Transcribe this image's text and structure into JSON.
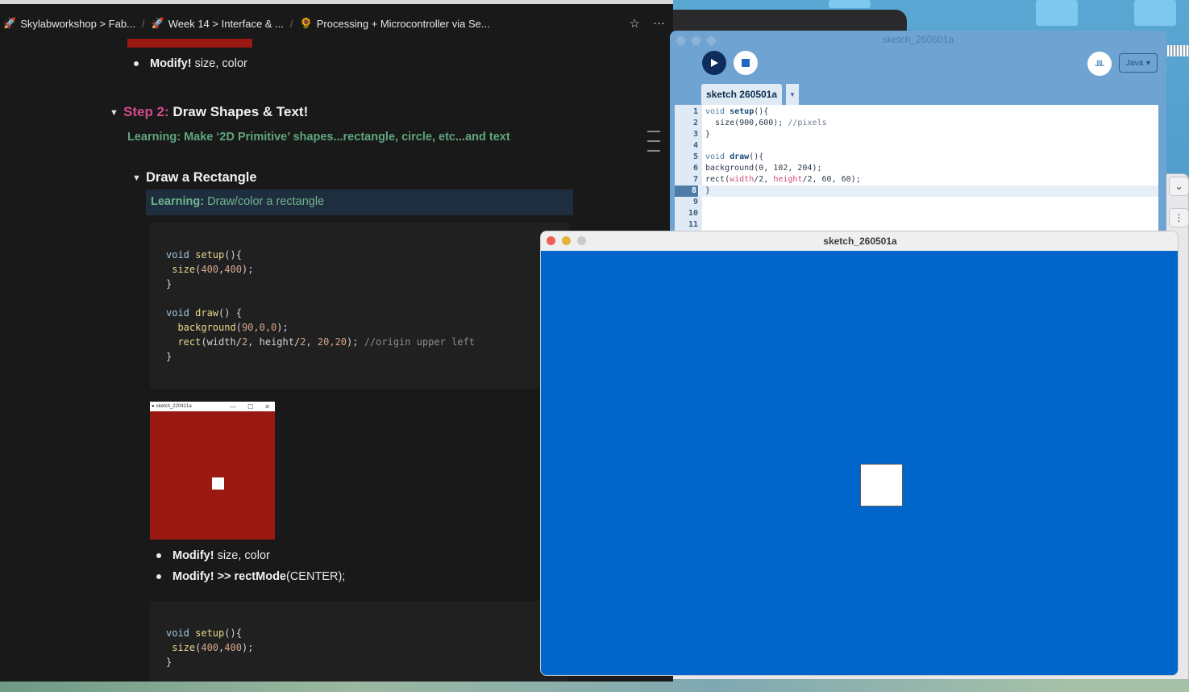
{
  "browser": {
    "breadcrumbs": [
      {
        "icon": "🚀",
        "label": "Skylabworkshop > Fab..."
      },
      {
        "icon": "🚀",
        "label": "Week 14 > Interface & ..."
      },
      {
        "icon": "🌻",
        "label": "Processing + Microcontroller via Se..."
      }
    ],
    "star_icon": "☆",
    "more_icon": "···"
  },
  "page": {
    "bullet_top": {
      "bold": "Modify!",
      "rest": " size, color"
    },
    "step_prefix": "Step 2:",
    "step_title": " Draw Shapes & Text!",
    "learning_step": "Learning: Make ‘2D Primitive’ shapes...rectangle, circle, etc...and text",
    "rect_heading": "Draw a Rectangle",
    "callout_bold": "Learning:",
    "callout_rest": " Draw/color a rectangle",
    "code1": {
      "l1_kw": "void ",
      "l1_fn": "setup",
      "l1_rest": "(){",
      "l2_fn": " size",
      "l2_a": "(",
      "l2_n1": "400",
      "l2_c": ",",
      "l2_n2": "400",
      "l2_e": ");",
      "l3": "}",
      "l5_kw": "void ",
      "l5_fn": "draw",
      "l5_rest": "() {",
      "l6_fn": "  background",
      "l6_a": "(",
      "l6_n": "90,0,0",
      "l6_e": ");",
      "l7_fn": "  rect",
      "l7_a": "(width/",
      "l7_n1": "2",
      "l7_b": ", height/",
      "l7_n2": "2",
      "l7_c": ", ",
      "l7_n3": "20,20",
      "l7_d": "); ",
      "l7_cm": "//origin upper left",
      "l8": "}"
    },
    "thumb_title": "sketch_220421a",
    "bullet_a": {
      "bold": "Modify!",
      "rest": "  size, color"
    },
    "bullet_b": {
      "bold": "Modify! >> rectMode",
      "rest": "(CENTER);"
    },
    "code2": {
      "l1_kw": "void ",
      "l1_fn": "setup",
      "l1_rest": "(){",
      "l2_fn": " size",
      "l2_a": "(",
      "l2_n1": "400",
      "l2_c": ",",
      "l2_n2": "400",
      "l2_e": ");",
      "l3": "}"
    }
  },
  "ide": {
    "window_title": "sketch_260501a",
    "tab_label": "sketch 260501a",
    "tab_menu": "▼",
    "mode_label": "Java",
    "mode_caret": "▾",
    "debug_icon": "ꔛ",
    "lines": [
      {
        "n": "1",
        "parts": [
          [
            "kw",
            "void "
          ],
          [
            "fn",
            "setup"
          ],
          [
            "",
            "(){"
          ]
        ]
      },
      {
        "n": "2",
        "parts": [
          [
            "",
            "  size(900,600); "
          ],
          [
            "cm",
            "//pixels"
          ]
        ]
      },
      {
        "n": "3",
        "parts": [
          [
            "",
            "}"
          ]
        ]
      },
      {
        "n": "4",
        "parts": []
      },
      {
        "n": "5",
        "parts": [
          [
            "kw",
            "void "
          ],
          [
            "fn",
            "draw"
          ],
          [
            "",
            "(){"
          ]
        ]
      },
      {
        "n": "6",
        "parts": [
          [
            "",
            "background(0, 102, 204);"
          ]
        ]
      },
      {
        "n": "7",
        "parts": [
          [
            "",
            "rect("
          ],
          [
            "red",
            "width"
          ],
          [
            "",
            "/2, "
          ],
          [
            "red",
            "height"
          ],
          [
            "",
            "/2, 60, 60);"
          ]
        ]
      },
      {
        "n": "8",
        "parts": [
          [
            "",
            "}"
          ]
        ]
      },
      {
        "n": "9",
        "parts": []
      },
      {
        "n": "10",
        "parts": []
      },
      {
        "n": "11",
        "parts": []
      }
    ],
    "current_line": 8
  },
  "sketch_window": {
    "title": "sketch_260501a",
    "background_color": "#0066cc",
    "rect_color": "#ffffff"
  },
  "colors": {
    "notion_bg": "#191919",
    "step_pink": "#d14d8f",
    "learning_green": "#5fa67f",
    "thumb_red": "#9a1a13",
    "ide_blue": "#6fa4d2"
  }
}
